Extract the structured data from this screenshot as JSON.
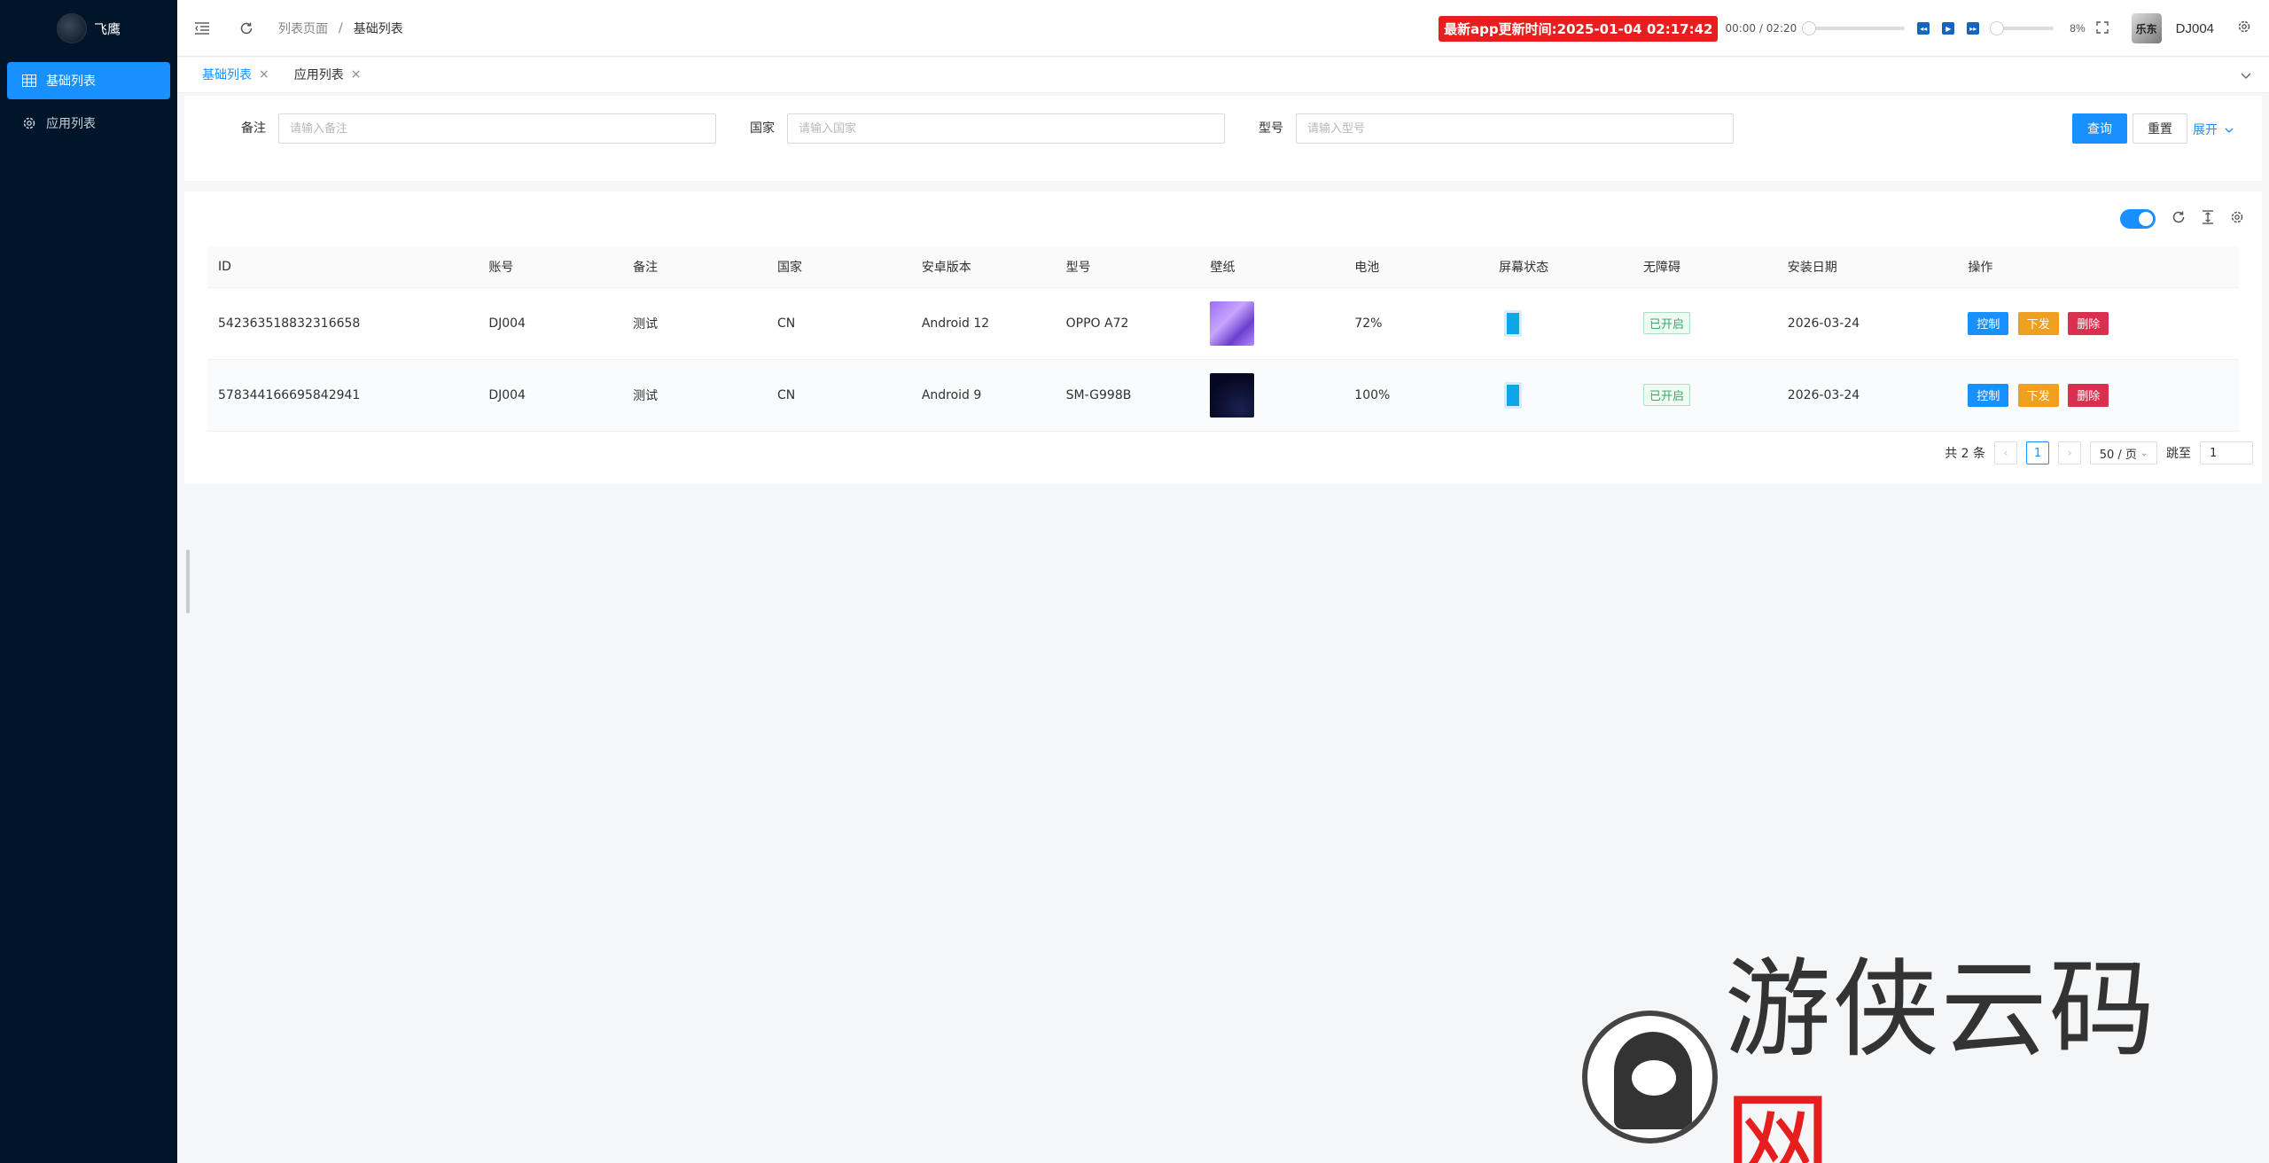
{
  "app": {
    "name": "飞鹰"
  },
  "sidebar": {
    "items": [
      {
        "label": "基础列表",
        "icon": "table-icon",
        "active": true
      },
      {
        "label": "应用列表",
        "icon": "gear-icon",
        "active": false
      }
    ]
  },
  "header": {
    "breadcrumb": [
      "列表页面",
      "基础列表"
    ],
    "breadcrumb_separator": "/",
    "notice": "最新app更新时间:2025-01-04 02:17:42",
    "player": {
      "time": "00:00 / 02:20",
      "volume_percent": "8%",
      "volume_level": 0.08
    },
    "avatar_text": "乐东",
    "username": "DJ004"
  },
  "tabs": [
    {
      "label": "基础列表",
      "active": true
    },
    {
      "label": "应用列表",
      "active": false
    }
  ],
  "search": {
    "fields": [
      {
        "label": "备注",
        "placeholder": "请输入备注"
      },
      {
        "label": "国家",
        "placeholder": "请输入国家"
      },
      {
        "label": "型号",
        "placeholder": "请输入型号"
      }
    ],
    "query_label": "查询",
    "reset_label": "重置",
    "expand_label": "展开"
  },
  "table": {
    "columns": [
      "ID",
      "账号",
      "备注",
      "国家",
      "安卓版本",
      "型号",
      "壁纸",
      "电池",
      "屏幕状态",
      "无障碍",
      "安装日期",
      "操作"
    ],
    "rows": [
      {
        "id": "542363518832316658",
        "account": "DJ004",
        "remark": "测试",
        "country": "CN",
        "android": "Android 12",
        "model": "OPPO A72",
        "battery": "72%",
        "accessibility": "已开启",
        "install_date": "2026-03-24"
      },
      {
        "id": "578344166695842941",
        "account": "DJ004",
        "remark": "测试",
        "country": "CN",
        "android": "Android 9",
        "model": "SM-G998B",
        "battery": "100%",
        "accessibility": "已开启",
        "install_date": "2026-03-24"
      }
    ],
    "actions": {
      "control": "控制",
      "send": "下发",
      "delete": "删除"
    }
  },
  "pagination": {
    "total_label": "共 2 条",
    "current_page": "1",
    "page_size": "50 / 页",
    "jump_label": "跳至",
    "jump_value": "1"
  },
  "watermark": {
    "text": "游侠云码",
    "accent": "网"
  },
  "colors": {
    "primary": "#1890ff",
    "sidebar": "#001529",
    "notice": "#e81e1e",
    "warning": "#f0a020",
    "danger": "#d9304f"
  }
}
